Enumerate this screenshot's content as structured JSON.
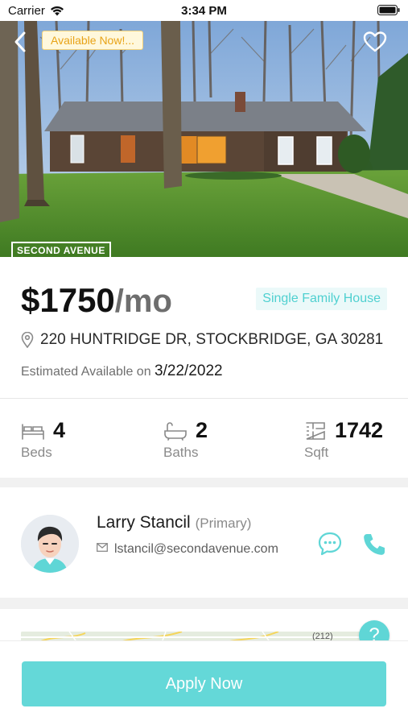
{
  "status_bar": {
    "carrier": "Carrier",
    "time": "3:34 PM"
  },
  "hero": {
    "badge": "Available Now!...",
    "brand": "SECOND AVENUE"
  },
  "listing": {
    "price": "$1750",
    "per": "/mo",
    "type": "Single Family House",
    "address": "220 HUNTRIDGE DR, STOCKBRIDGE, GA 30281",
    "available_label": "Estimated Available on",
    "available_date": "3/22/2022"
  },
  "stats": [
    {
      "value": "4",
      "label": "Beds",
      "icon": "bed-icon"
    },
    {
      "value": "2",
      "label": "Baths",
      "icon": "bathtub-icon"
    },
    {
      "value": "1742",
      "label": "Sqft",
      "icon": "floorplan-icon"
    }
  ],
  "agent": {
    "name": "Larry Stancil",
    "role": "(Primary)",
    "email": "lstancil@secondavenue.com"
  },
  "map": {
    "road_label": "(212)"
  },
  "help": {
    "label": "?"
  },
  "cta": {
    "apply_label": "Apply Now"
  },
  "colors": {
    "accent": "#64d8d8",
    "badge_text": "#e8a317",
    "tag_bg": "#ebf9f9"
  }
}
